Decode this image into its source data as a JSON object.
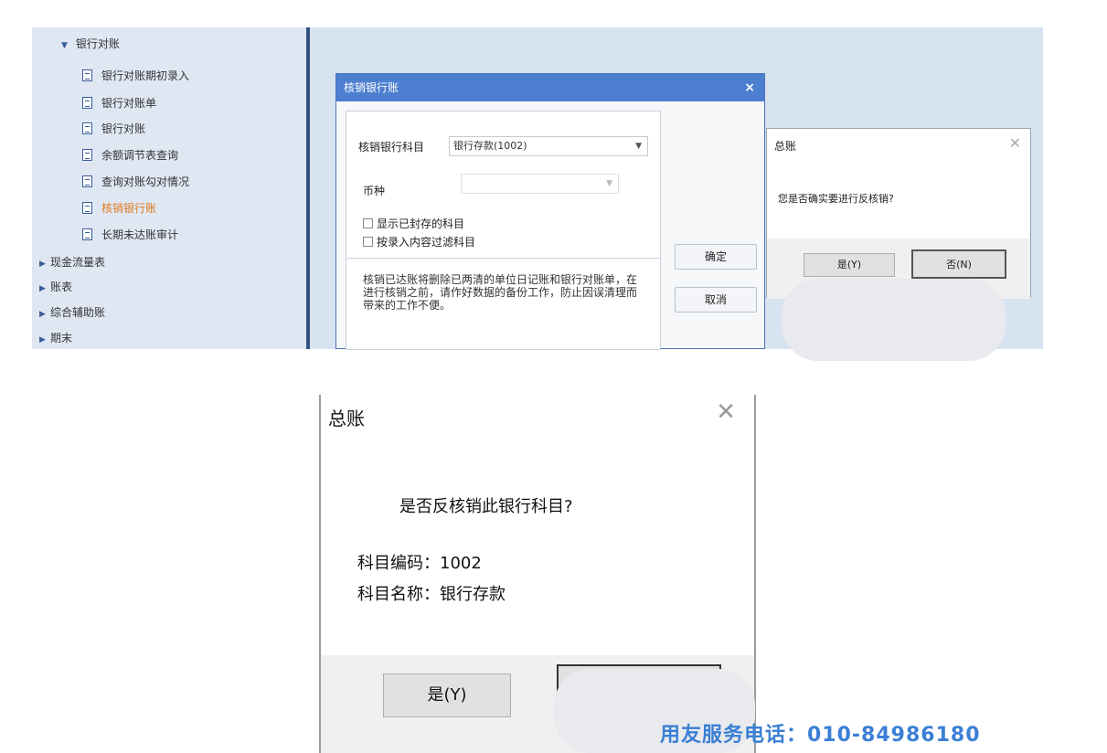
{
  "sidebar": {
    "group_bank": "银行对账",
    "items": [
      "银行对账期初录入",
      "银行对账单",
      "银行对账",
      "余额调节表查询",
      "查询对账勾对情况",
      "核销银行账",
      "长期未达账审计"
    ],
    "active_index": 5,
    "groups": [
      "现金流量表",
      "账表",
      "综合辅助账",
      "期末"
    ]
  },
  "dialog_writeoff": {
    "title": "核销银行账",
    "close": "×",
    "subject_label": "核销银行科目",
    "subject_value": "银行存款(1002)",
    "currency_label": "币种",
    "currency_value": "",
    "check_sealed": "显示已封存的科目",
    "check_filter": "按录入内容过滤科目",
    "note": "核销已达账将删除已两清的单位日记账和银行对账单，在进行核销之前，请作好数据的备份工作，防止因误清理而带来的工作不便。",
    "ok_label": "确定",
    "cancel_label": "取消"
  },
  "dialog_confirm_small": {
    "title": "总账",
    "message": "您是否确实要进行反核销?",
    "yes_label": "是(Y)",
    "no_label": "否(N)"
  },
  "dialog_confirm_large": {
    "title": "总账",
    "message": "是否反核销此银行科目?",
    "code_line": "科目编码：1002",
    "name_line": "科目名称：银行存款",
    "yes_label": "是(Y)"
  },
  "hotline": "用友服务电话：010-84986180",
  "colors": {
    "titlebar": "#4d7fd0",
    "active_item": "#e07a1f",
    "hotline": "#3a7fd5"
  }
}
